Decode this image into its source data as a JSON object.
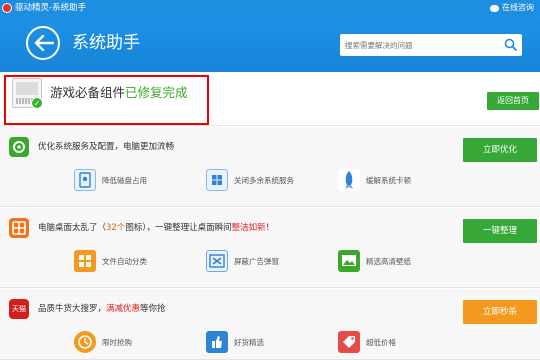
{
  "window": {
    "title": "驱动精灵-系统助手",
    "consult_label": "在线咨询"
  },
  "header": {
    "title": "系统助手",
    "search_placeholder": "搜索需要解决的问题"
  },
  "status": {
    "prefix": "游戏必备组件",
    "result": "已修复完成",
    "home_button": "返回首页"
  },
  "colors": {
    "brand_blue": "#1e8fe0",
    "green": "#3aa82b",
    "orange": "#f39a1e",
    "red_box": "#e00000"
  },
  "sections": [
    {
      "title_parts": [
        "优化系统服务及配置，电脑更加流畅"
      ],
      "button": "立即优化",
      "icon": "shield-gear-icon",
      "features": [
        {
          "label": "降低磁盘占用",
          "icon": "disk-icon"
        },
        {
          "label": "关闭多余系统服务",
          "icon": "windows-icon"
        },
        {
          "label": "缓解系统卡顿",
          "icon": "rocket-icon"
        }
      ]
    },
    {
      "title_a": "电脑桌面太乱了（",
      "title_count": "32个",
      "title_b": "图标），一键整理让桌面瞬间",
      "title_red": "整洁如新",
      "title_c": "！",
      "button": "一键整理",
      "icon": "desktop-grid-icon",
      "features": [
        {
          "label": "文件自动分类",
          "icon": "grid-icon"
        },
        {
          "label": "屏蔽广告弹窗",
          "icon": "block-popup-icon"
        },
        {
          "label": "精选高清壁纸",
          "icon": "wallpaper-icon"
        }
      ]
    },
    {
      "title_a": "品质牛货大搜罗，",
      "title_hl": "满减优惠",
      "title_b": "等你抢",
      "button": "立即秒杀",
      "icon_text": "天猫",
      "icon": "tmall-icon",
      "features": [
        {
          "label": "限时抢购",
          "icon": "clock-icon"
        },
        {
          "label": "好货精选",
          "icon": "thumbs-up-icon"
        },
        {
          "label": "超低价格",
          "icon": "price-tag-icon"
        }
      ]
    }
  ]
}
